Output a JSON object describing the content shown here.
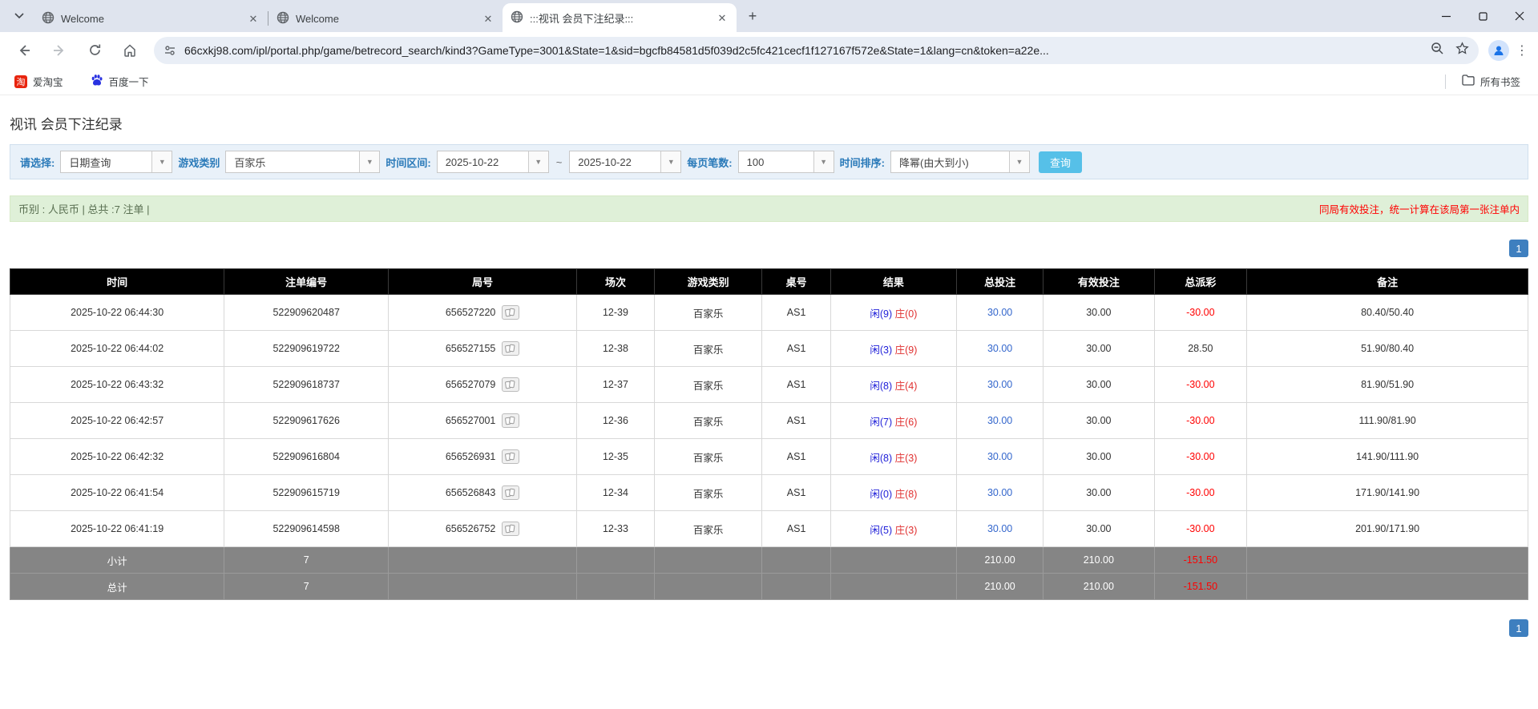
{
  "browser": {
    "tabs": [
      {
        "label": "Welcome"
      },
      {
        "label": "Welcome"
      },
      {
        "label": ":::视讯 会员下注纪录:::"
      }
    ],
    "new_tab": "+",
    "url": "66cxkj98.com/ipl/portal.php/game/betrecord_search/kind3?GameType=3001&State=1&sid=bgcfb84581d5f039d2c5fc421cecf1f127167f572e&State=1&lang=cn&token=a22e...",
    "bookmarks": {
      "taobao": "爱淘宝",
      "baidu": "百度一下",
      "all_bookmarks": "所有书签",
      "taobao_glyph": "淘"
    },
    "menu_dots": "⋮"
  },
  "page": {
    "title": "视讯 会员下注纪录",
    "filters": {
      "select_label": "请选择:",
      "select_value": "日期查询",
      "game_type_label": "游戏类别",
      "game_type_value": "百家乐",
      "date_range_label": "时间区间:",
      "date_from": "2025-10-22",
      "date_separator": "~",
      "date_to": "2025-10-22",
      "page_size_label": "每页笔数:",
      "page_size_value": "100",
      "sort_label": "时间排序:",
      "sort_value": "降幂(由大到小)",
      "search_button": "查询",
      "dropdown_arrow": "▼"
    },
    "info_bar": {
      "summary": "币别 : 人民币 | 总共 :7 注单 |",
      "notice": "同局有效投注，统一计算在该局第一张注单内"
    },
    "pagination": {
      "page": "1"
    }
  },
  "table": {
    "headers": [
      "时间",
      "注单编号",
      "局号",
      "场次",
      "游戏类别",
      "桌号",
      "结果",
      "总投注",
      "有效投注",
      "总派彩",
      "备注"
    ],
    "rows": [
      {
        "time": "2025-10-22 06:44:30",
        "bet_id": "522909620487",
        "round": "656527220",
        "session": "12-39",
        "game": "百家乐",
        "table_no": "AS1",
        "result_player": "闲(9)",
        "result_banker": "庄(0)",
        "total_bet": "30.00",
        "valid_bet": "30.00",
        "payout": "-30.00",
        "remark": "80.40/50.40"
      },
      {
        "time": "2025-10-22 06:44:02",
        "bet_id": "522909619722",
        "round": "656527155",
        "session": "12-38",
        "game": "百家乐",
        "table_no": "AS1",
        "result_player": "闲(3)",
        "result_banker": "庄(9)",
        "total_bet": "30.00",
        "valid_bet": "30.00",
        "payout": "28.50",
        "remark": "51.90/80.40"
      },
      {
        "time": "2025-10-22 06:43:32",
        "bet_id": "522909618737",
        "round": "656527079",
        "session": "12-37",
        "game": "百家乐",
        "table_no": "AS1",
        "result_player": "闲(8)",
        "result_banker": "庄(4)",
        "total_bet": "30.00",
        "valid_bet": "30.00",
        "payout": "-30.00",
        "remark": "81.90/51.90"
      },
      {
        "time": "2025-10-22 06:42:57",
        "bet_id": "522909617626",
        "round": "656527001",
        "session": "12-36",
        "game": "百家乐",
        "table_no": "AS1",
        "result_player": "闲(7)",
        "result_banker": "庄(6)",
        "total_bet": "30.00",
        "valid_bet": "30.00",
        "payout": "-30.00",
        "remark": "111.90/81.90"
      },
      {
        "time": "2025-10-22 06:42:32",
        "bet_id": "522909616804",
        "round": "656526931",
        "session": "12-35",
        "game": "百家乐",
        "table_no": "AS1",
        "result_player": "闲(8)",
        "result_banker": "庄(3)",
        "total_bet": "30.00",
        "valid_bet": "30.00",
        "payout": "-30.00",
        "remark": "141.90/111.90"
      },
      {
        "time": "2025-10-22 06:41:54",
        "bet_id": "522909615719",
        "round": "656526843",
        "session": "12-34",
        "game": "百家乐",
        "table_no": "AS1",
        "result_player": "闲(0)",
        "result_banker": "庄(8)",
        "total_bet": "30.00",
        "valid_bet": "30.00",
        "payout": "-30.00",
        "remark": "171.90/141.90"
      },
      {
        "time": "2025-10-22 06:41:19",
        "bet_id": "522909614598",
        "round": "656526752",
        "session": "12-33",
        "game": "百家乐",
        "table_no": "AS1",
        "result_player": "闲(5)",
        "result_banker": "庄(3)",
        "total_bet": "30.00",
        "valid_bet": "30.00",
        "payout": "-30.00",
        "remark": "201.90/171.90"
      }
    ],
    "subtotal": {
      "label": "小计",
      "count": "7",
      "total_bet": "210.00",
      "valid_bet": "210.00",
      "payout": "-151.50"
    },
    "total": {
      "label": "总计",
      "count": "7",
      "total_bet": "210.00",
      "valid_bet": "210.00",
      "payout": "-151.50"
    }
  },
  "colors": {
    "header_bg": "#000000",
    "summary_bg": "#858585",
    "filter_bg": "#e9f1f9",
    "filter_label": "#2a7ab9",
    "info_bg": "#dff0d8",
    "notice_red": "#ff0000",
    "player_blue": "#1f1fd8",
    "banker_red": "#e03030",
    "bet_blue": "#3366cc",
    "search_btn": "#56c0e8",
    "pager_blue": "#3e7fbf"
  }
}
